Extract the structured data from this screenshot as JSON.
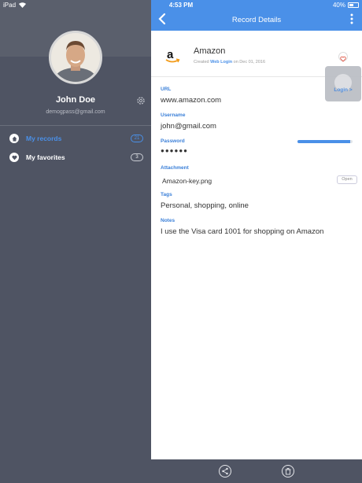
{
  "status_bar": {
    "device": "iPad",
    "time": "4:53 PM",
    "battery": "40%"
  },
  "profile": {
    "name": "John Doe",
    "email": "demogpass@gmail.com"
  },
  "nav": [
    {
      "label": "My records",
      "count": "21",
      "active": true
    },
    {
      "label": "My favorites",
      "count": "3",
      "active": false
    }
  ],
  "header": {
    "title": "Record Details"
  },
  "record": {
    "name": "Amazon",
    "created_prefix": "Created",
    "created_type": "Web Login",
    "created_suffix": "on Dec 01, 2016",
    "login_label": "Login >"
  },
  "fields": {
    "url_label": "URL",
    "url_value": "www.amazon.com",
    "username_label": "Username",
    "username_value": "john@gmail.com",
    "password_label": "Password",
    "password_value": "●●●●●●",
    "password_strength": 0.95,
    "attachment_label": "Attachment",
    "attachment_value": "Amazon-key.png",
    "open_label": "Open",
    "tags_label": "Tags",
    "tags_value": "Personal, shopping, online",
    "notes_label": "Notes",
    "notes_value": "I use the Visa card 1001 for shopping on Amazon"
  },
  "colors": {
    "accent": "#4a90e8",
    "sidebar": "#4f5463"
  },
  "icons": {
    "gear": "gear-icon",
    "back": "back-arrow-icon",
    "more": "more-vertical-icon",
    "share": "share-icon",
    "delete": "trash-icon"
  }
}
